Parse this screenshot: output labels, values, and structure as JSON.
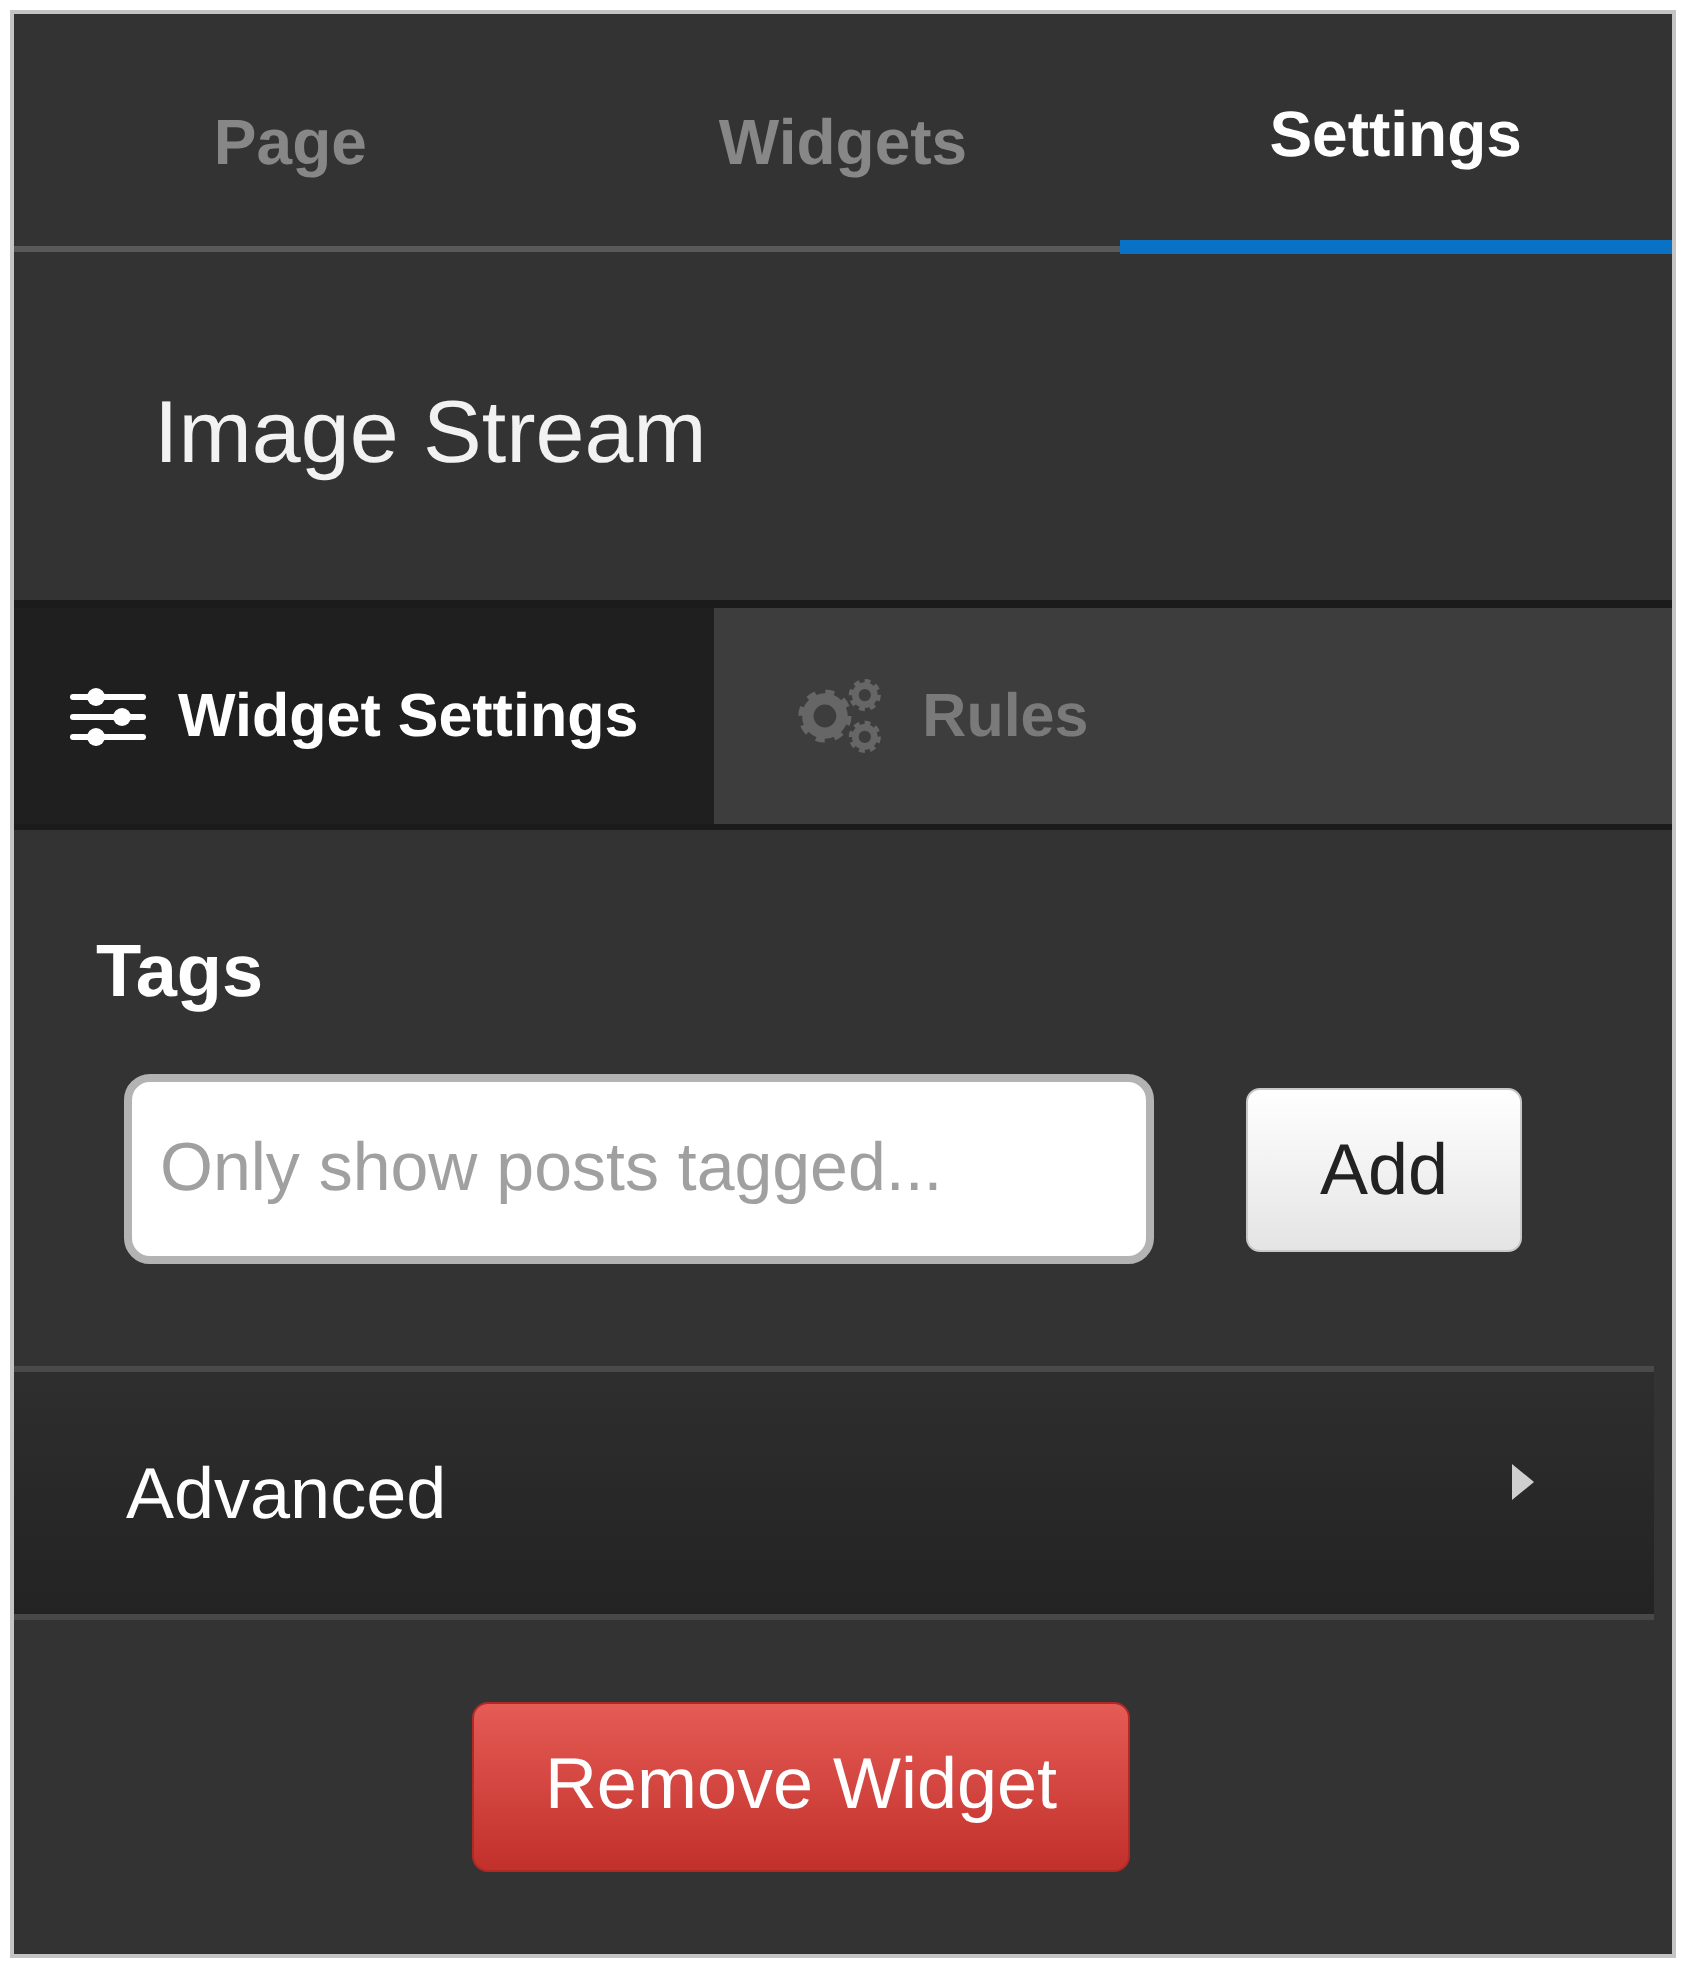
{
  "tabs": [
    {
      "label": "Page",
      "selected": false
    },
    {
      "label": "Widgets",
      "selected": false
    },
    {
      "label": "Settings",
      "selected": true
    }
  ],
  "title": "Image Stream",
  "subtabs": [
    {
      "label": "Widget Settings",
      "selected": true
    },
    {
      "label": "Rules",
      "selected": false
    }
  ],
  "tags": {
    "label": "Tags",
    "field": {
      "placeholder": "Only show posts tagged..."
    },
    "button": "Add"
  },
  "advanced": {
    "label": "Advanced",
    "expanded": false
  },
  "remove_button": "Remove Widget"
}
